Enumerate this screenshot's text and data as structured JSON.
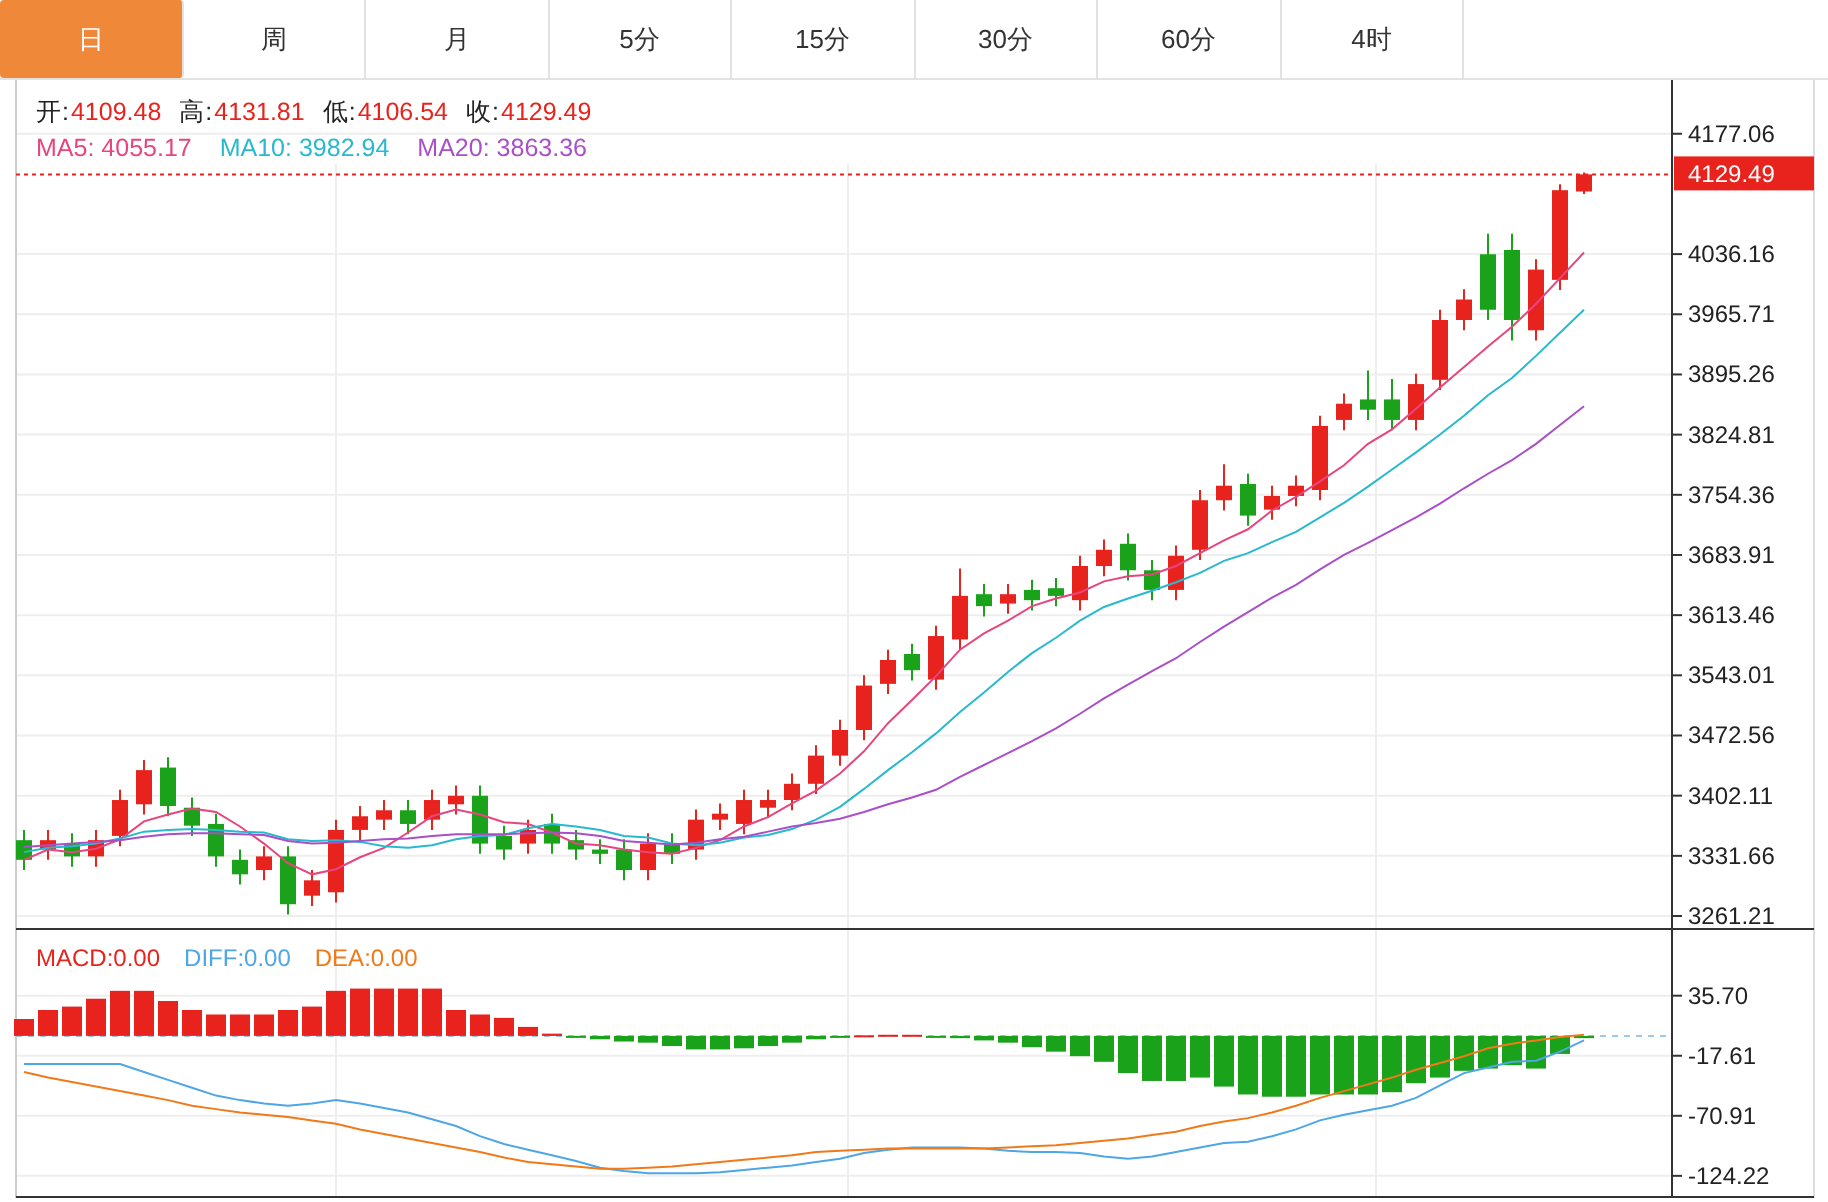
{
  "tabs": [
    {
      "label": "日",
      "selected": true
    },
    {
      "label": "周",
      "selected": false
    },
    {
      "label": "月",
      "selected": false
    },
    {
      "label": "5分",
      "selected": false
    },
    {
      "label": "15分",
      "selected": false
    },
    {
      "label": "30分",
      "selected": false
    },
    {
      "label": "60分",
      "selected": false
    },
    {
      "label": "4时",
      "selected": false
    }
  ],
  "quote": [
    {
      "label": "开:",
      "value": "4109.48"
    },
    {
      "label": "高:",
      "value": "4131.81"
    },
    {
      "label": "低:",
      "value": "4106.54"
    },
    {
      "label": "收:",
      "value": "4129.49"
    }
  ],
  "moving_averages": [
    {
      "value": "4055.17"
    },
    {
      "value": "3982.94"
    },
    {
      "value": "3863.36"
    }
  ],
  "price_chart": {
    "chart_data": {
      "type": "candlestick",
      "grid": true,
      "ylim": [
        3246,
        4240
      ],
      "yticks": [
        4177.06,
        4036.16,
        3965.71,
        3895.26,
        3824.81,
        3754.36,
        3683.91,
        3613.46,
        3543.01,
        3472.56,
        3402.11,
        3331.66,
        3261.21
      ],
      "ref_lines": [
        {
          "axis": "y",
          "value": 4129.49,
          "label": "4129.49",
          "color": "#e8231d"
        }
      ],
      "ohlc": [
        [
          3350,
          3362,
          3315,
          3327
        ],
        [
          3339,
          3362,
          3327,
          3350
        ],
        [
          3346,
          3358,
          3319,
          3331
        ],
        [
          3331,
          3362,
          3319,
          3350
        ],
        [
          3355,
          3409,
          3343,
          3397
        ],
        [
          3392,
          3444,
          3380,
          3432
        ],
        [
          3435,
          3447,
          3378,
          3390
        ],
        [
          3388,
          3400,
          3355,
          3367
        ],
        [
          3369,
          3381,
          3319,
          3331
        ],
        [
          3327,
          3339,
          3298,
          3310
        ],
        [
          3315,
          3343,
          3303,
          3331
        ],
        [
          3331,
          3343,
          3263,
          3275
        ],
        [
          3285,
          3315,
          3273,
          3303
        ],
        [
          3289,
          3374,
          3277,
          3362
        ],
        [
          3362,
          3390,
          3350,
          3378
        ],
        [
          3374,
          3397,
          3362,
          3385
        ],
        [
          3385,
          3397,
          3357,
          3369
        ],
        [
          3374,
          3409,
          3362,
          3397
        ],
        [
          3392,
          3414,
          3380,
          3402
        ],
        [
          3402,
          3414,
          3334,
          3346
        ],
        [
          3355,
          3367,
          3327,
          3339
        ],
        [
          3346,
          3374,
          3334,
          3362
        ],
        [
          3369,
          3381,
          3334,
          3346
        ],
        [
          3350,
          3362,
          3327,
          3339
        ],
        [
          3339,
          3351,
          3322,
          3334
        ],
        [
          3339,
          3351,
          3303,
          3315
        ],
        [
          3315,
          3358,
          3303,
          3346
        ],
        [
          3346,
          3358,
          3322,
          3334
        ],
        [
          3339,
          3386,
          3327,
          3374
        ],
        [
          3374,
          3393,
          3362,
          3381
        ],
        [
          3369,
          3409,
          3357,
          3397
        ],
        [
          3388,
          3409,
          3376,
          3397
        ],
        [
          3397,
          3428,
          3385,
          3416
        ],
        [
          3416,
          3461,
          3404,
          3449
        ],
        [
          3449,
          3491,
          3437,
          3479
        ],
        [
          3479,
          3543,
          3467,
          3531
        ],
        [
          3533,
          3573,
          3521,
          3561
        ],
        [
          3568,
          3580,
          3537,
          3549
        ],
        [
          3538,
          3601,
          3526,
          3589
        ],
        [
          3585,
          3668,
          3573,
          3636
        ],
        [
          3638,
          3650,
          3612,
          3624
        ],
        [
          3627,
          3650,
          3615,
          3638
        ],
        [
          3643,
          3655,
          3619,
          3631
        ],
        [
          3645,
          3657,
          3624,
          3636
        ],
        [
          3631,
          3683,
          3619,
          3671
        ],
        [
          3671,
          3702,
          3659,
          3690
        ],
        [
          3697,
          3709,
          3654,
          3666
        ],
        [
          3666,
          3678,
          3631,
          3643
        ],
        [
          3643,
          3695,
          3631,
          3683
        ],
        [
          3690,
          3760,
          3678,
          3748
        ],
        [
          3748,
          3790,
          3736,
          3765
        ],
        [
          3767,
          3779,
          3718,
          3730
        ],
        [
          3737,
          3765,
          3725,
          3753
        ],
        [
          3753,
          3777,
          3741,
          3765
        ],
        [
          3760,
          3847,
          3748,
          3835
        ],
        [
          3842,
          3873,
          3830,
          3861
        ],
        [
          3866,
          3900,
          3842,
          3854
        ],
        [
          3866,
          3890,
          3830,
          3842
        ],
        [
          3842,
          3896,
          3830,
          3884
        ],
        [
          3889,
          3971,
          3877,
          3959
        ],
        [
          3959,
          3995,
          3947,
          3983
        ],
        [
          4036,
          4060,
          3959,
          3971
        ],
        [
          4041,
          4060,
          3935,
          3959
        ],
        [
          3947,
          4030,
          3935,
          4018
        ],
        [
          4006,
          4118,
          3994,
          4111
        ],
        [
          4109.48,
          4131.81,
          4106.54,
          4129.49
        ]
      ],
      "series": [
        {
          "name": "MA5:",
          "type": "line",
          "color": "#e8457e",
          "values": [
            3327,
            3339,
            3336,
            3340,
            3351,
            3372,
            3380,
            3387,
            3383,
            3366,
            3346,
            3323,
            3310,
            3316,
            3330,
            3341,
            3359,
            3378,
            3386,
            3380,
            3371,
            3369,
            3359,
            3346,
            3344,
            3339,
            3336,
            3334,
            3341,
            3350,
            3366,
            3377,
            3393,
            3408,
            3428,
            3454,
            3487,
            3514,
            3542,
            3573,
            3592,
            3607,
            3624,
            3633,
            3640,
            3653,
            3659,
            3661,
            3671,
            3686,
            3701,
            3714,
            3736,
            3752,
            3770,
            3789,
            3814,
            3831,
            3855,
            3880,
            3904,
            3928,
            3951,
            3978,
            4008,
            4038
          ]
        },
        {
          "name": "MA10:",
          "type": "line",
          "color": "#28b9cf",
          "values": [
            3336,
            3341,
            3343,
            3346,
            3352,
            3360,
            3362,
            3363,
            3362,
            3360,
            3359,
            3351,
            3349,
            3350,
            3348,
            3343,
            3341,
            3344,
            3351,
            3355,
            3356,
            3364,
            3369,
            3366,
            3362,
            3355,
            3353,
            3346,
            3344,
            3347,
            3353,
            3356,
            3363,
            3374,
            3389,
            3410,
            3432,
            3453,
            3475,
            3500,
            3523,
            3547,
            3569,
            3587,
            3607,
            3623,
            3633,
            3642,
            3652,
            3663,
            3677,
            3686,
            3699,
            3711,
            3728,
            3745,
            3764,
            3784,
            3804,
            3825,
            3847,
            3871,
            3891,
            3917,
            3944,
            3971
          ]
        },
        {
          "name": "MA20:",
          "type": "line",
          "color": "#a94fc7",
          "values": [
            3342,
            3344,
            3346,
            3348,
            3350,
            3354,
            3357,
            3358,
            3358,
            3357,
            3356,
            3349,
            3346,
            3347,
            3349,
            3351,
            3352,
            3355,
            3357,
            3357,
            3357,
            3358,
            3359,
            3358,
            3355,
            3349,
            3347,
            3345,
            3347,
            3351,
            3354,
            3360,
            3366,
            3370,
            3375,
            3383,
            3392,
            3400,
            3409,
            3424,
            3438,
            3452,
            3466,
            3481,
            3498,
            3516,
            3532,
            3548,
            3563,
            3582,
            3600,
            3617,
            3634,
            3649,
            3667,
            3684,
            3698,
            3713,
            3728,
            3744,
            3762,
            3779,
            3795,
            3814,
            3836,
            3858
          ]
        }
      ]
    }
  },
  "macd_legend": [
    {
      "value": "0.00"
    },
    {
      "value": "0.00"
    },
    {
      "value": "0.00"
    }
  ],
  "macd_chart": {
    "chart_data": {
      "type": "bar",
      "grid": true,
      "ylim": [
        -143,
        94
      ],
      "yticks": [
        {
          "value": 35.7,
          "label": "35.70"
        },
        -17.61,
        -70.91,
        -124.22
      ],
      "ref_lines": [
        {
          "axis": "y",
          "value": 0,
          "color": "#9cc8ea"
        }
      ],
      "series": [
        {
          "name": "MACD:",
          "color": "#e8231d",
          "values": [
            15,
            23,
            26,
            33,
            40,
            40,
            31,
            23,
            19,
            19,
            19,
            23,
            26,
            40,
            42,
            42,
            42,
            42,
            23,
            19,
            16,
            8,
            2,
            null,
            null,
            null,
            null,
            null,
            null,
            null,
            null,
            null,
            null,
            null,
            null,
            0.5,
            1,
            1,
            null,
            null,
            null,
            null,
            null,
            null,
            null,
            null,
            null,
            null,
            null,
            null,
            null,
            null,
            null,
            null,
            null,
            null,
            null,
            null,
            null,
            null,
            null,
            null,
            null,
            null,
            null,
            null
          ]
        },
        {
          "color": "#1aa31a",
          "values": [
            null,
            null,
            null,
            null,
            null,
            null,
            null,
            null,
            null,
            null,
            null,
            null,
            null,
            null,
            null,
            null,
            null,
            null,
            null,
            null,
            null,
            null,
            null,
            -1,
            -3,
            -5,
            -6,
            -9,
            -12,
            -12,
            -11,
            -9,
            -6,
            -3,
            -1,
            null,
            null,
            null,
            -1,
            -2,
            -4,
            -6,
            -10,
            -14,
            -18,
            -23,
            -33,
            -40,
            -40,
            -37,
            -45,
            -52,
            -54,
            -54,
            -52,
            -52,
            -52,
            -50,
            -42,
            -37,
            -31,
            -29,
            -26,
            -29,
            -16,
            -2
          ]
        },
        {
          "name": "DIFF:",
          "type": "line",
          "color": "#4ea6e6",
          "values": [
            -25,
            -25,
            -25,
            -25,
            -25,
            -32,
            -39,
            -46,
            -53,
            -57,
            -60,
            -62,
            -60,
            -57,
            -60,
            -64,
            -68,
            -74,
            -80,
            -89,
            -96,
            -101,
            -106,
            -111,
            -117,
            -120,
            -122,
            -122,
            -122,
            -121,
            -119,
            -117,
            -115,
            -112,
            -109,
            -104,
            -101,
            -99,
            -99,
            -99,
            -100,
            -102,
            -103,
            -103,
            -104,
            -107,
            -109,
            -107,
            -103,
            -99,
            -95,
            -94,
            -89,
            -83,
            -75,
            -70,
            -66,
            -62,
            -55,
            -44,
            -33,
            -28,
            -23,
            -22,
            -14,
            -4
          ]
        },
        {
          "name": "DEA:",
          "type": "line",
          "color": "#f07a1a",
          "values": [
            -32,
            -37,
            -41,
            -45,
            -49,
            -53,
            -57,
            -62,
            -65,
            -68,
            -70,
            -72,
            -75,
            -78,
            -83,
            -87,
            -91,
            -95,
            -99,
            -103,
            -108,
            -112,
            -114,
            -116,
            -118,
            -118,
            -117,
            -116,
            -114,
            -112,
            -110,
            -108,
            -106,
            -103,
            -102,
            -101,
            -100,
            -100,
            -100,
            -100,
            -100,
            -99,
            -98,
            -97,
            -95,
            -93,
            -91,
            -88,
            -85,
            -80,
            -76,
            -73,
            -68,
            -62,
            -55,
            -49,
            -43,
            -37,
            -30,
            -24,
            -18,
            -11,
            -7,
            -4,
            -1,
            1
          ]
        }
      ]
    }
  }
}
